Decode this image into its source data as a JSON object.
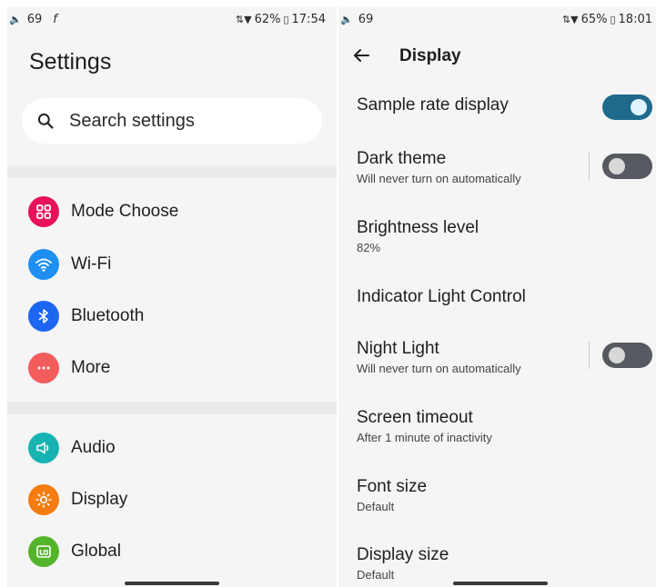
{
  "left": {
    "status": {
      "volume": "69",
      "aux": "f",
      "battery": "62%",
      "time": "17:54"
    },
    "title": "Settings",
    "search_placeholder": "Search settings",
    "menu": [
      {
        "label": "Mode Choose",
        "icon": "grid-icon",
        "color": "#e8125a"
      },
      {
        "label": "Wi-Fi",
        "icon": "wifi-icon",
        "color": "#1f8ef1"
      },
      {
        "label": "Bluetooth",
        "icon": "bluetooth-icon",
        "color": "#1c66f2"
      },
      {
        "label": "More",
        "icon": "more-dots-icon",
        "color": "#f25c5c"
      },
      {
        "label": "Audio",
        "icon": "speaker-icon",
        "color": "#17b3b3"
      },
      {
        "label": "Display",
        "icon": "brightness-icon",
        "color": "#f57c10"
      },
      {
        "label": "Global",
        "icon": "global-icon",
        "color": "#55b52a"
      }
    ]
  },
  "right": {
    "status": {
      "volume": "69",
      "battery": "65%",
      "time": "18:01"
    },
    "title": "Display",
    "rows": [
      {
        "title": "Sample rate display",
        "subtitle": "",
        "toggle": "on"
      },
      {
        "title": "Dark theme",
        "subtitle": "Will never turn on automatically",
        "toggle": "off"
      },
      {
        "title": "Brightness level",
        "subtitle": "82%"
      },
      {
        "title": "Indicator Light Control",
        "subtitle": ""
      },
      {
        "title": "Night Light",
        "subtitle": "Will never turn on automatically",
        "toggle": "off"
      },
      {
        "title": "Screen timeout",
        "subtitle": "After 1 minute of inactivity"
      },
      {
        "title": "Font size",
        "subtitle": "Default"
      },
      {
        "title": "Display size",
        "subtitle": "Default"
      }
    ]
  }
}
